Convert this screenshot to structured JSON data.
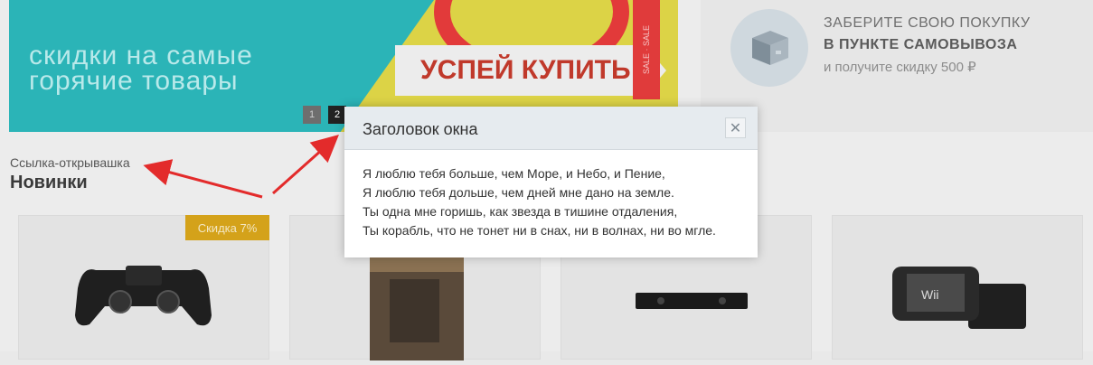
{
  "banner": {
    "tagline_line1": "скидки на самые",
    "tagline_line2": "горячие товары",
    "cta": "УСПЕЙ КУПИТЬ",
    "sale_tape": "SALE · SALE",
    "slides": [
      "1",
      "2"
    ],
    "active_slide": "2"
  },
  "promo": {
    "line1": "ЗАБЕРИТЕ СВОЮ ПОКУПКУ",
    "line2": "В ПУНКТЕ САМОВЫВОЗА",
    "line3": "и получите скидку 500 ₽",
    "icon": "box-icon"
  },
  "section": {
    "opener_link": "Ссылка-открывашка",
    "title": "Новинки"
  },
  "products": [
    {
      "badge": "Скидка 7%",
      "image": "gamepad-image"
    },
    {
      "badge": "",
      "image": "game-cover-image"
    },
    {
      "badge": "",
      "image": "camera-image"
    },
    {
      "badge": "",
      "image": "console-image"
    }
  ],
  "modal": {
    "title": "Заголовок окна",
    "close_icon": "close-icon",
    "lines": [
      "Я люблю тебя больше, чем Море, и Небо, и Пение,",
      "Я люблю тебя дольше, чем дней мне дано на земле.",
      "Ты одна мне горишь, как звезда в тишине отдаления,",
      "Ты корабль, что не тонет ни в снах, ни в волнах, ни во мгле."
    ]
  },
  "colors": {
    "arrow": "#e32b2b",
    "badge": "#d4a21a",
    "modal_header": "#e6ebef"
  }
}
